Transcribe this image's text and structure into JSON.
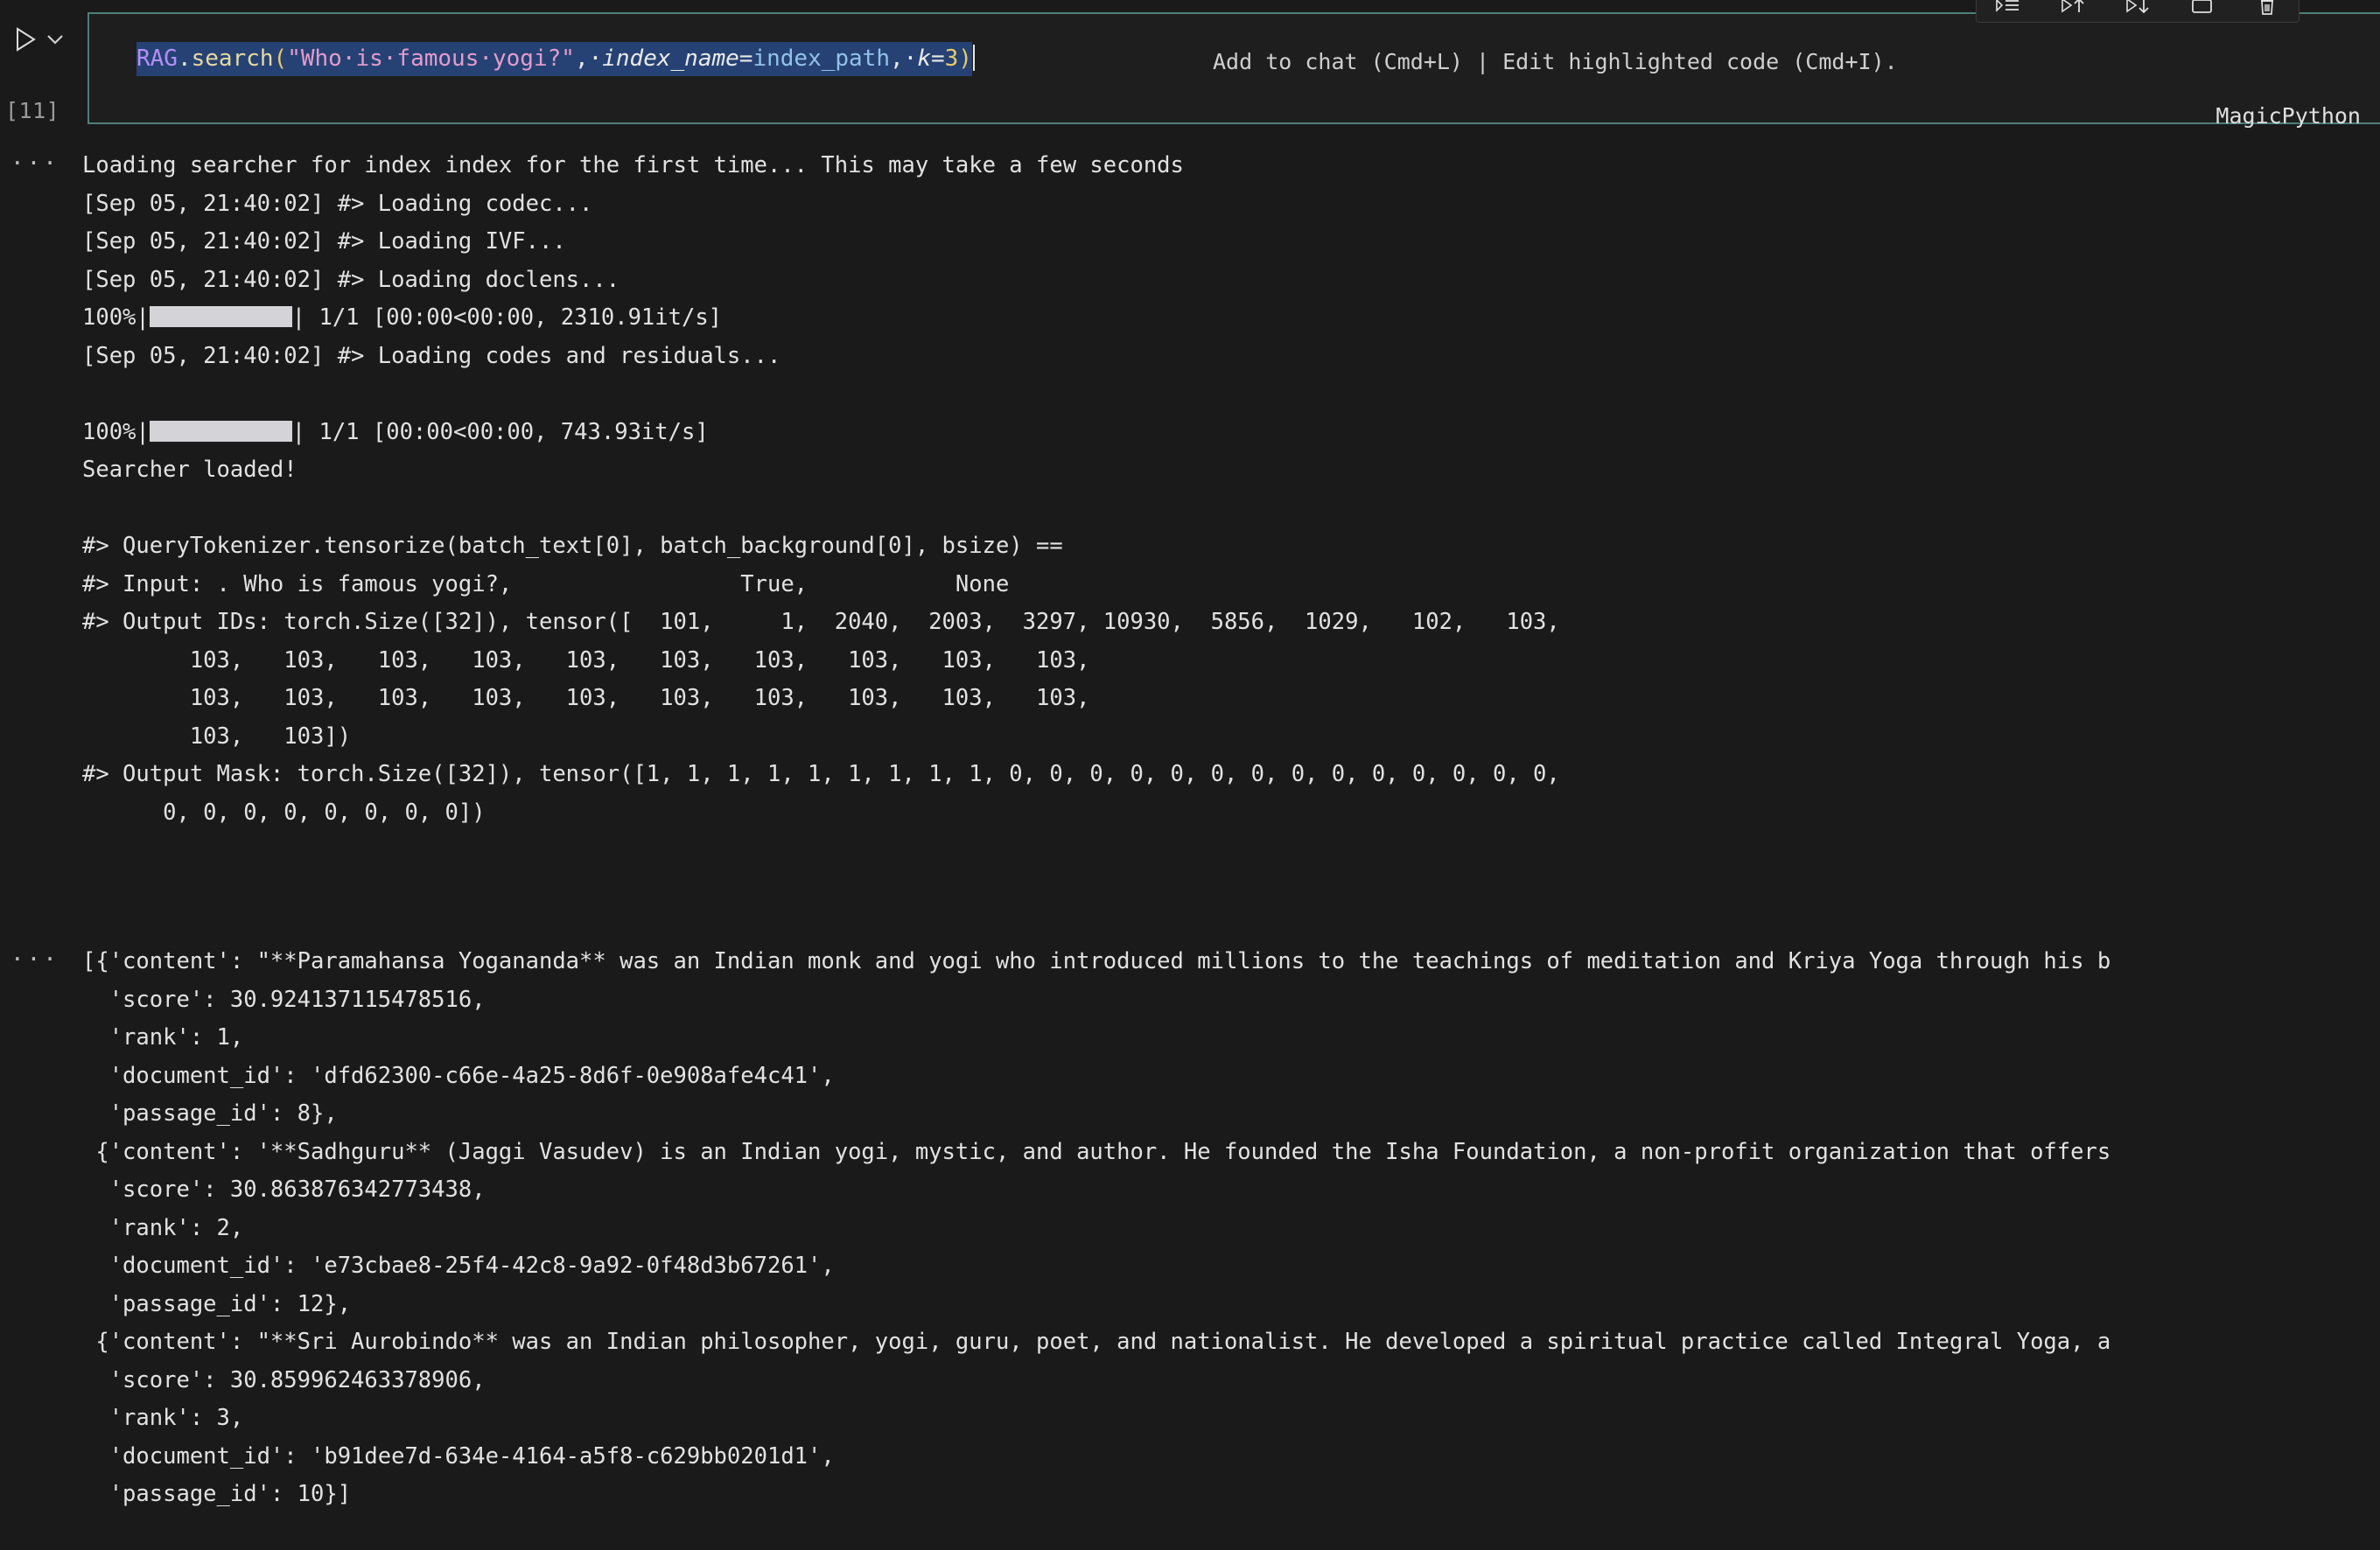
{
  "toolbar": {
    "icons": [
      {
        "name": "run-by-line-icon",
        "title": "Run by Line"
      },
      {
        "name": "run-above-icon",
        "title": "Execute Above Cells"
      },
      {
        "name": "run-below-icon",
        "title": "Execute Cell and Below"
      },
      {
        "name": "stop-icon",
        "title": "Interrupt"
      },
      {
        "name": "delete-icon",
        "title": "Delete Cell"
      }
    ]
  },
  "cell": {
    "execution_count": "[11]",
    "run_icon": "play-icon",
    "chevron_icon": "chevron-down-icon",
    "language_mode": "MagicPython",
    "hint": "Add to chat (Cmd+L) | Edit highlighted code (Cmd+I).",
    "code_tokens": {
      "class": "RAG",
      "dot": ".",
      "fn": "search",
      "open_paren": "(",
      "string": "\"Who·is·famous·yogi?\"",
      "comma1": ",·",
      "kwarg1": "index_name",
      "eq1": "=",
      "var1": "index_path",
      "comma2": ",·",
      "kwarg2": "k",
      "eq2": "=",
      "num": "3",
      "close_paren": ")"
    },
    "code_plain": "RAG.search(\"Who is famous yogi?\", index_name=index_path, k=3)"
  },
  "output_1": {
    "dots": "···",
    "lines": [
      {
        "text": "Loading searcher for index index for the first time... This may take a few seconds"
      },
      {
        "text": "[Sep 05, 21:40:02] #> Loading codec..."
      },
      {
        "text": "[Sep 05, 21:40:02] #> Loading IVF..."
      },
      {
        "text": "[Sep 05, 21:40:02] #> Loading doclens..."
      },
      {
        "pre": "100%|",
        "bar": true,
        "post": "| 1/1 [00:00<00:00, 2310.91it/s]"
      },
      {
        "text": "[Sep 05, 21:40:02] #> Loading codes and residuals..."
      },
      {
        "text": ""
      },
      {
        "pre": "100%|",
        "bar": true,
        "post": "| 1/1 [00:00<00:00, 743.93it/s]"
      },
      {
        "text": "Searcher loaded!"
      },
      {
        "text": ""
      },
      {
        "text": "#> QueryTokenizer.tensorize(batch_text[0], batch_background[0], bsize) =="
      },
      {
        "text": "#> Input: . Who is famous yogi?, \t\t True, \t\t None"
      },
      {
        "text": "#> Output IDs: torch.Size([32]), tensor([  101,     1,  2040,  2003,  3297, 10930,  5856,  1029,   102,   103,"
      },
      {
        "text": "        103,   103,   103,   103,   103,   103,   103,   103,   103,   103,"
      },
      {
        "text": "        103,   103,   103,   103,   103,   103,   103,   103,   103,   103,"
      },
      {
        "text": "        103,   103])"
      },
      {
        "text": "#> Output Mask: torch.Size([32]), tensor([1, 1, 1, 1, 1, 1, 1, 1, 1, 0, 0, 0, 0, 0, 0, 0, 0, 0, 0, 0, 0, 0, 0,"
      },
      {
        "text": "      0, 0, 0, 0, 0, 0, 0, 0])"
      }
    ]
  },
  "output_2": {
    "dots": "···",
    "lines": [
      {
        "text": "[{'content': \"**Paramahansa Yogananda** was an Indian monk and yogi who introduced millions to the teachings of meditation and Kriya Yoga through his b"
      },
      {
        "text": "  'score': 30.924137115478516,"
      },
      {
        "text": "  'rank': 1,"
      },
      {
        "text": "  'document_id': 'dfd62300-c66e-4a25-8d6f-0e908afe4c41',"
      },
      {
        "text": "  'passage_id': 8},"
      },
      {
        "text": " {'content': '**Sadhguru** (Jaggi Vasudev) is an Indian yogi, mystic, and author. He founded the Isha Foundation, a non-profit organization that offers"
      },
      {
        "text": "  'score': 30.863876342773438,"
      },
      {
        "text": "  'rank': 2,"
      },
      {
        "text": "  'document_id': 'e73cbae8-25f4-42c8-9a92-0f48d3b67261',"
      },
      {
        "text": "  'passage_id': 12},"
      },
      {
        "text": " {'content': \"**Sri Aurobindo** was an Indian philosopher, yogi, guru, poet, and nationalist. He developed a spiritual practice called Integral Yoga, a"
      },
      {
        "text": "  'score': 30.859962463378906,"
      },
      {
        "text": "  'rank': 3,"
      },
      {
        "text": "  'document_id': 'b91dee7d-634e-4164-a5f8-c629bb0201d1',"
      },
      {
        "text": "  'passage_id': 10}]"
      }
    ]
  },
  "colors": {
    "background": "#1a1a1a",
    "editor_background": "#1e1e1e",
    "cell_border": "#4d8078",
    "selection": "#264274",
    "text": "#e2e2e2",
    "progress_bar": "#d4d4d8"
  }
}
